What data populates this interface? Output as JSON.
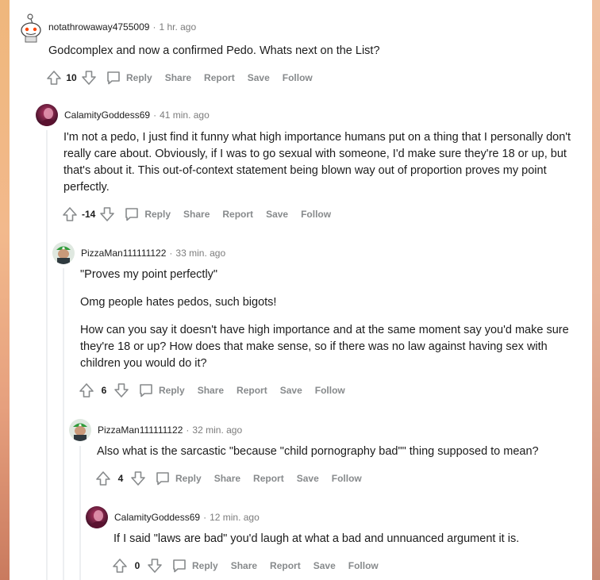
{
  "comments": [
    {
      "username": "notathrowaway4755009",
      "time": "1 hr. ago",
      "text": [
        "Godcomplex and now a confirmed Pedo. Whats next on the List?"
      ],
      "score": "10",
      "actions": [
        "Reply",
        "Share",
        "Report",
        "Save",
        "Follow"
      ]
    },
    {
      "username": "CalamityGoddess69",
      "time": "41 min. ago",
      "text": [
        "I'm not a pedo, I just find it funny what high importance humans put on a thing that I personally don't really care about. Obviously, if I was to go sexual with someone, I'd make sure they're 18 or up, but that's about it. This out-of-context statement being blown way out of proportion proves my point perfectly."
      ],
      "score": "-14",
      "actions": [
        "Reply",
        "Share",
        "Report",
        "Save",
        "Follow"
      ]
    },
    {
      "username": "PizzaMan111111122",
      "time": "33 min. ago",
      "text": [
        "\"Proves my point perfectly\"",
        "Omg people hates pedos, such bigots!",
        "How can you say it doesn't have high importance and at the same moment say you'd make sure they're 18 or up? How does that make sense, so if there was no law against having sex with children you would do it?"
      ],
      "score": "6",
      "actions": [
        "Reply",
        "Share",
        "Report",
        "Save",
        "Follow"
      ]
    },
    {
      "username": "PizzaMan111111122",
      "time": "32 min. ago",
      "text": [
        "Also what is the sarcastic \"because \"child pornography bad\"\" thing supposed to mean?"
      ],
      "score": "4",
      "actions": [
        "Reply",
        "Share",
        "Report",
        "Save",
        "Follow"
      ]
    },
    {
      "username": "CalamityGoddess69",
      "time": "12 min. ago",
      "text": [
        "If I said \"laws are bad\" you'd laugh at what a bad and unnuanced argument it is."
      ],
      "score": "0",
      "actions": [
        "Reply",
        "Share",
        "Report",
        "Save",
        "Follow"
      ]
    }
  ],
  "separator": "·",
  "icons": {
    "upvote": "arrow-up-outline-icon",
    "downvote": "arrow-down-outline-icon",
    "reply": "speech-bubble-icon"
  },
  "colors": {
    "text": "#1c1c1c",
    "meta": "#7c7c7c",
    "action": "#878a8c",
    "thread_line": "#edeff1"
  }
}
